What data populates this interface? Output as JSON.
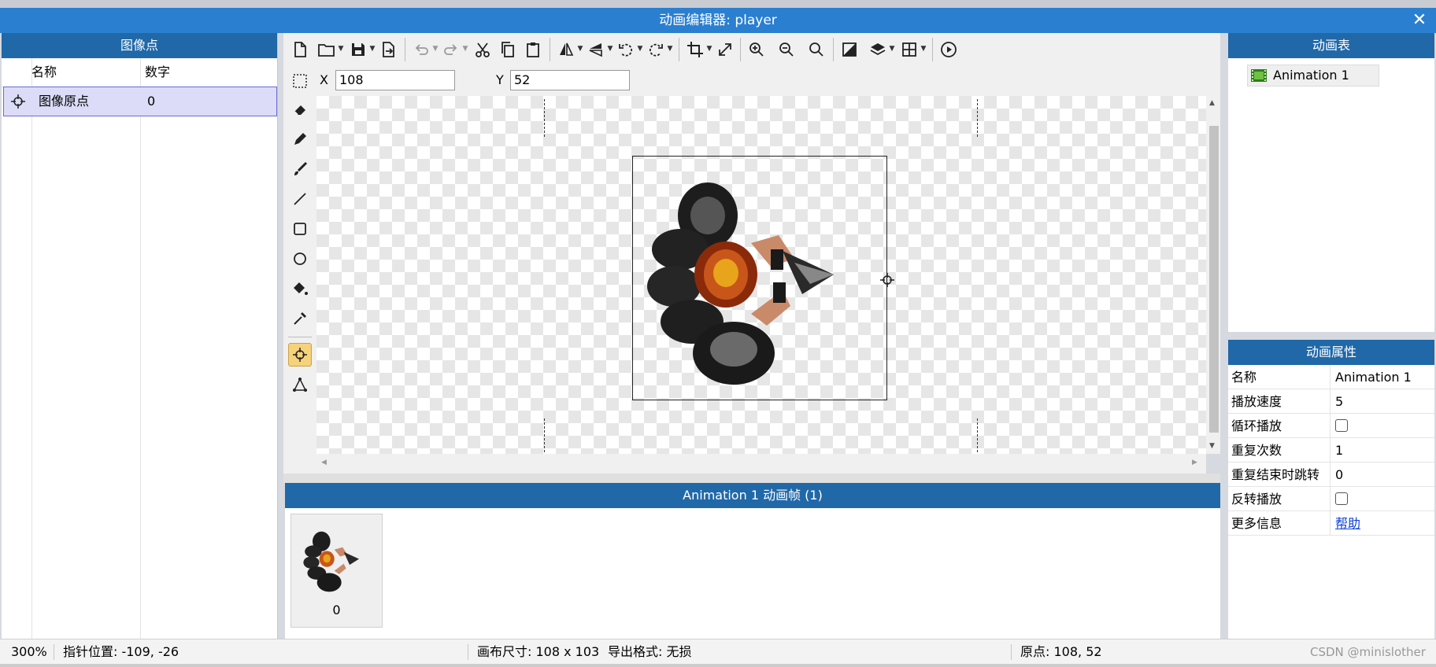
{
  "window": {
    "title": "动画编辑器:  player",
    "close_glyph": "✕"
  },
  "left_panel": {
    "title": "图像点",
    "columns": [
      "名称",
      "数字"
    ],
    "rows": [
      {
        "icon": "crosshair-icon",
        "name": "图像原点",
        "number": "0"
      }
    ]
  },
  "toolbar": {
    "icons": [
      "new-file-icon",
      "open-folder-icon",
      "save-icon",
      "export-icon",
      "undo-icon",
      "redo-icon",
      "cut-icon",
      "copy-icon",
      "paste-icon",
      "flip-horizontal-icon",
      "flip-vertical-icon",
      "rotate-ccw-icon",
      "rotate-cw-icon",
      "crop-icon",
      "resize-icon",
      "zoom-in-icon",
      "zoom-out-icon",
      "zoom-reset-icon",
      "color-adjust-icon",
      "layers-icon",
      "grid-icon",
      "play-icon"
    ]
  },
  "coords": {
    "x_label": "X",
    "x_value": "108",
    "y_label": "Y",
    "y_value": "52"
  },
  "tools": [
    "select-icon",
    "eraser-icon",
    "pencil-icon",
    "brush-icon",
    "line-icon",
    "rectangle-icon",
    "ellipse-icon",
    "fill-bucket-icon",
    "eyedropper-icon",
    "origin-point-icon",
    "polygon-points-icon"
  ],
  "frames_panel": {
    "title": "Animation 1 动画帧 (1)",
    "frames": [
      {
        "label": "0"
      }
    ]
  },
  "animation_list": {
    "title": "动画表",
    "items": [
      {
        "label": "Animation 1",
        "icon": "film-icon"
      }
    ]
  },
  "animation_props": {
    "title": "动画属性",
    "rows": [
      {
        "key": "名称",
        "value": "Animation 1",
        "type": "text"
      },
      {
        "key": "播放速度",
        "value": "5",
        "type": "text"
      },
      {
        "key": "循环播放",
        "value": false,
        "type": "checkbox"
      },
      {
        "key": "重复次数",
        "value": "1",
        "type": "text"
      },
      {
        "key": "重复结束时跳转",
        "value": "0",
        "type": "text"
      },
      {
        "key": "反转播放",
        "value": false,
        "type": "checkbox"
      },
      {
        "key": "更多信息",
        "value": "帮助",
        "type": "link"
      }
    ]
  },
  "status": {
    "zoom": "300%",
    "pointer": "指针位置: -109, -26",
    "canvas_size": "画布尺寸:  108 x 103",
    "export_format": "导出格式:  无损",
    "origin": "原点:  108, 52",
    "watermark": "CSDN @minislother"
  },
  "colors": {
    "titlebar": "#2a7fd0",
    "panel_header": "#2068a8",
    "selection": "#dcdcf8",
    "tool_active": "#f6d27a"
  }
}
